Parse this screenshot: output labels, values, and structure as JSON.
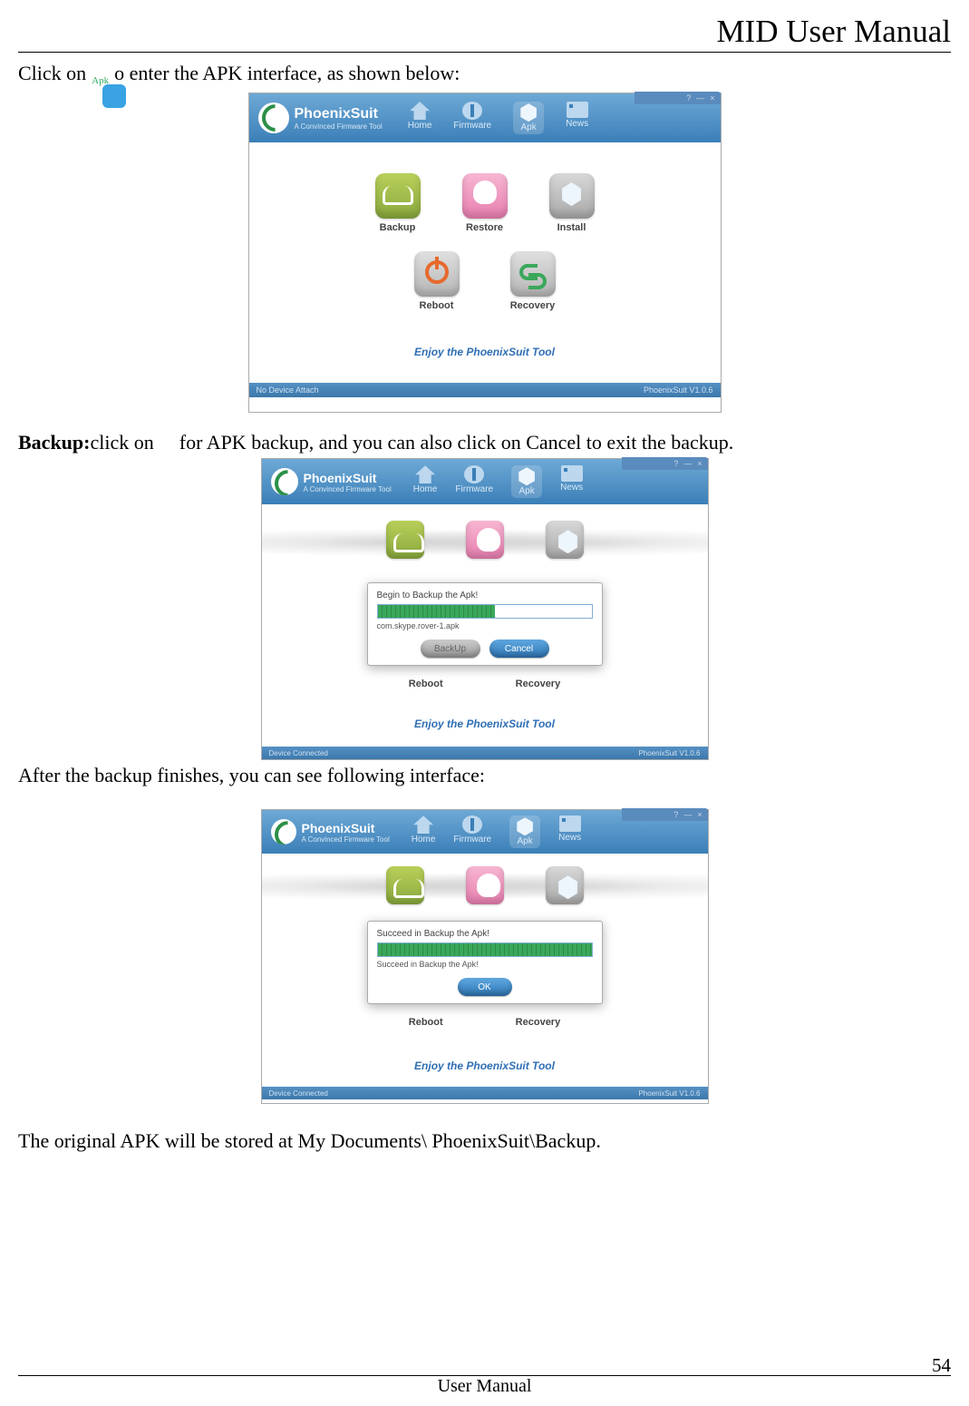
{
  "header_title": "MID User Manual",
  "line1_pre": "Click on",
  "line1_post": "o enter the APK interface, as shown below:",
  "apk_icon_label": "Apk",
  "line2_prefix": "Backup:",
  "line2_mid": " click on",
  "line2_post": " for APK backup, and you can also click on Cancel to exit the backup.",
  "after_backup_text": "After the backup finishes, you can see following interface:",
  "storage_text": "The original APK will be stored at My Documents\\ PhoenixSuit\\Backup.",
  "page_footer_label": "User Manual",
  "page_number": "54",
  "app": {
    "name": "PhoenixSuit",
    "tagline": "A Convinced Firmware Tool",
    "nav": {
      "home": "Home",
      "firmware": "Firmware",
      "apk": "Apk",
      "news": "News"
    },
    "win_controls": {
      "help": "?",
      "min": "—",
      "close": "×"
    },
    "tools": {
      "backup": "Backup",
      "restore": "Restore",
      "install": "Install",
      "reboot": "Reboot",
      "recovery": "Recovery"
    },
    "enjoy": "Enjoy the PhoenixSuit Tool",
    "footer_left_none": "No Device Attach",
    "footer_left_connected": "Device Connected",
    "footer_right": "PhoenixSuit V1.0.6"
  },
  "dialog_backup": {
    "title": "Begin to Backup the Apk!",
    "file": "com.skype.rover-1.apk",
    "btn_backup": "BackUp",
    "btn_cancel": "Cancel"
  },
  "dialog_done": {
    "title": "Succeed in Backup the Apk!",
    "result": "Succeed in Backup the Apk!",
    "btn_ok": "OK"
  }
}
